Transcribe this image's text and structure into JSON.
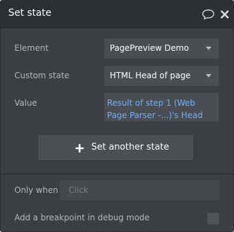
{
  "window": {
    "title": "Set state"
  },
  "icons": {
    "comment": "comment-icon",
    "close": "close-icon",
    "caret": "chevron-down-icon",
    "plus": "plus-icon"
  },
  "fields": {
    "element": {
      "label": "Element",
      "value": "PagePreview Demo"
    },
    "custom_state": {
      "label": "Custom state",
      "value": "HTML Head of page"
    },
    "value": {
      "label": "Value",
      "value": "Result of step 1 (Web Page Parser -...)'s Head"
    }
  },
  "actions": {
    "set_another_label": "Set another state"
  },
  "only_when": {
    "label": "Only when",
    "placeholder": "Click"
  },
  "breakpoint": {
    "label": "Add a breakpoint in debug mode",
    "checked": false
  },
  "colors": {
    "panel_bg": "#3b3e42",
    "titlebar_bg": "#2d3033",
    "input_bg": "#4a4d52",
    "dynamic_text": "#6fb0ff"
  }
}
